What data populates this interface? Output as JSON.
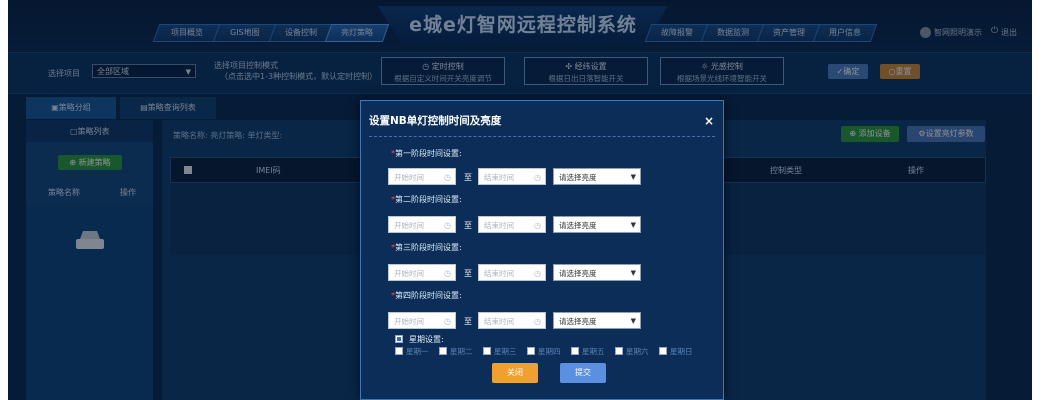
{
  "header": {
    "title": "e城e灯智网远程控制系统",
    "nav_left": [
      "项目概览",
      "GIS地图",
      "设备控制",
      "亮灯策略"
    ],
    "nav_right": [
      "故障报警",
      "数据监测",
      "资产管理",
      "用户信息"
    ],
    "active_tab": "亮灯策略",
    "user": "智网照明演示",
    "logout": "退出"
  },
  "controls": {
    "project_label": "选择项目",
    "project_value": "全部区域",
    "mode_hint_1": "选择项目控制模式",
    "mode_hint_2": "（点击选中1-3种控制模式，默认定时控制）",
    "modes": [
      {
        "icon": "clock-icon",
        "title": "定时控制",
        "sub": "根据自定义时间开关亮度调节"
      },
      {
        "icon": "globe-icon",
        "title": "经纬设置",
        "sub": "根据日出日落智能开关"
      },
      {
        "icon": "sun-icon",
        "title": "光感控制",
        "sub": "根据场景光线环境智能开关"
      }
    ],
    "confirm": "确定",
    "reset": "重置"
  },
  "left": {
    "tabs": [
      "策略分组",
      "策略查询列表"
    ],
    "list_title": "策略列表",
    "new_button": "新建策略",
    "col_name": "策略名称",
    "col_op": "操作"
  },
  "main": {
    "info": "策略名称:  亮灯策略:  单灯类型:",
    "add_device": "添加设备",
    "set_params": "设置亮灯参数",
    "columns": [
      "IMEI码",
      "控制类型",
      "操作"
    ]
  },
  "modal": {
    "title": "设置NB单灯控制时间及亮度",
    "close": "×",
    "stages": [
      {
        "label": "第一阶段时间设置:"
      },
      {
        "label": "第二阶段时间设置:"
      },
      {
        "label": "第三阶段时间设置:"
      },
      {
        "label": "第四阶段时间设置:"
      }
    ],
    "start_placeholder": "开始时间",
    "end_placeholder": "结束时间",
    "to": "至",
    "brightness_placeholder": "请选择亮度",
    "week_label": "星期设置:",
    "days": [
      "星期一",
      "星期二",
      "星期三",
      "星期四",
      "星期五",
      "星期六",
      "星期日"
    ],
    "close_button": "关闭",
    "submit_button": "提交"
  },
  "colors": {
    "app_bg": "#0b2a50",
    "accent_blue": "#2a6bd0",
    "button_orange": "#f0a030",
    "button_blue": "#5b8fe0",
    "green": "#2f9a3f"
  }
}
